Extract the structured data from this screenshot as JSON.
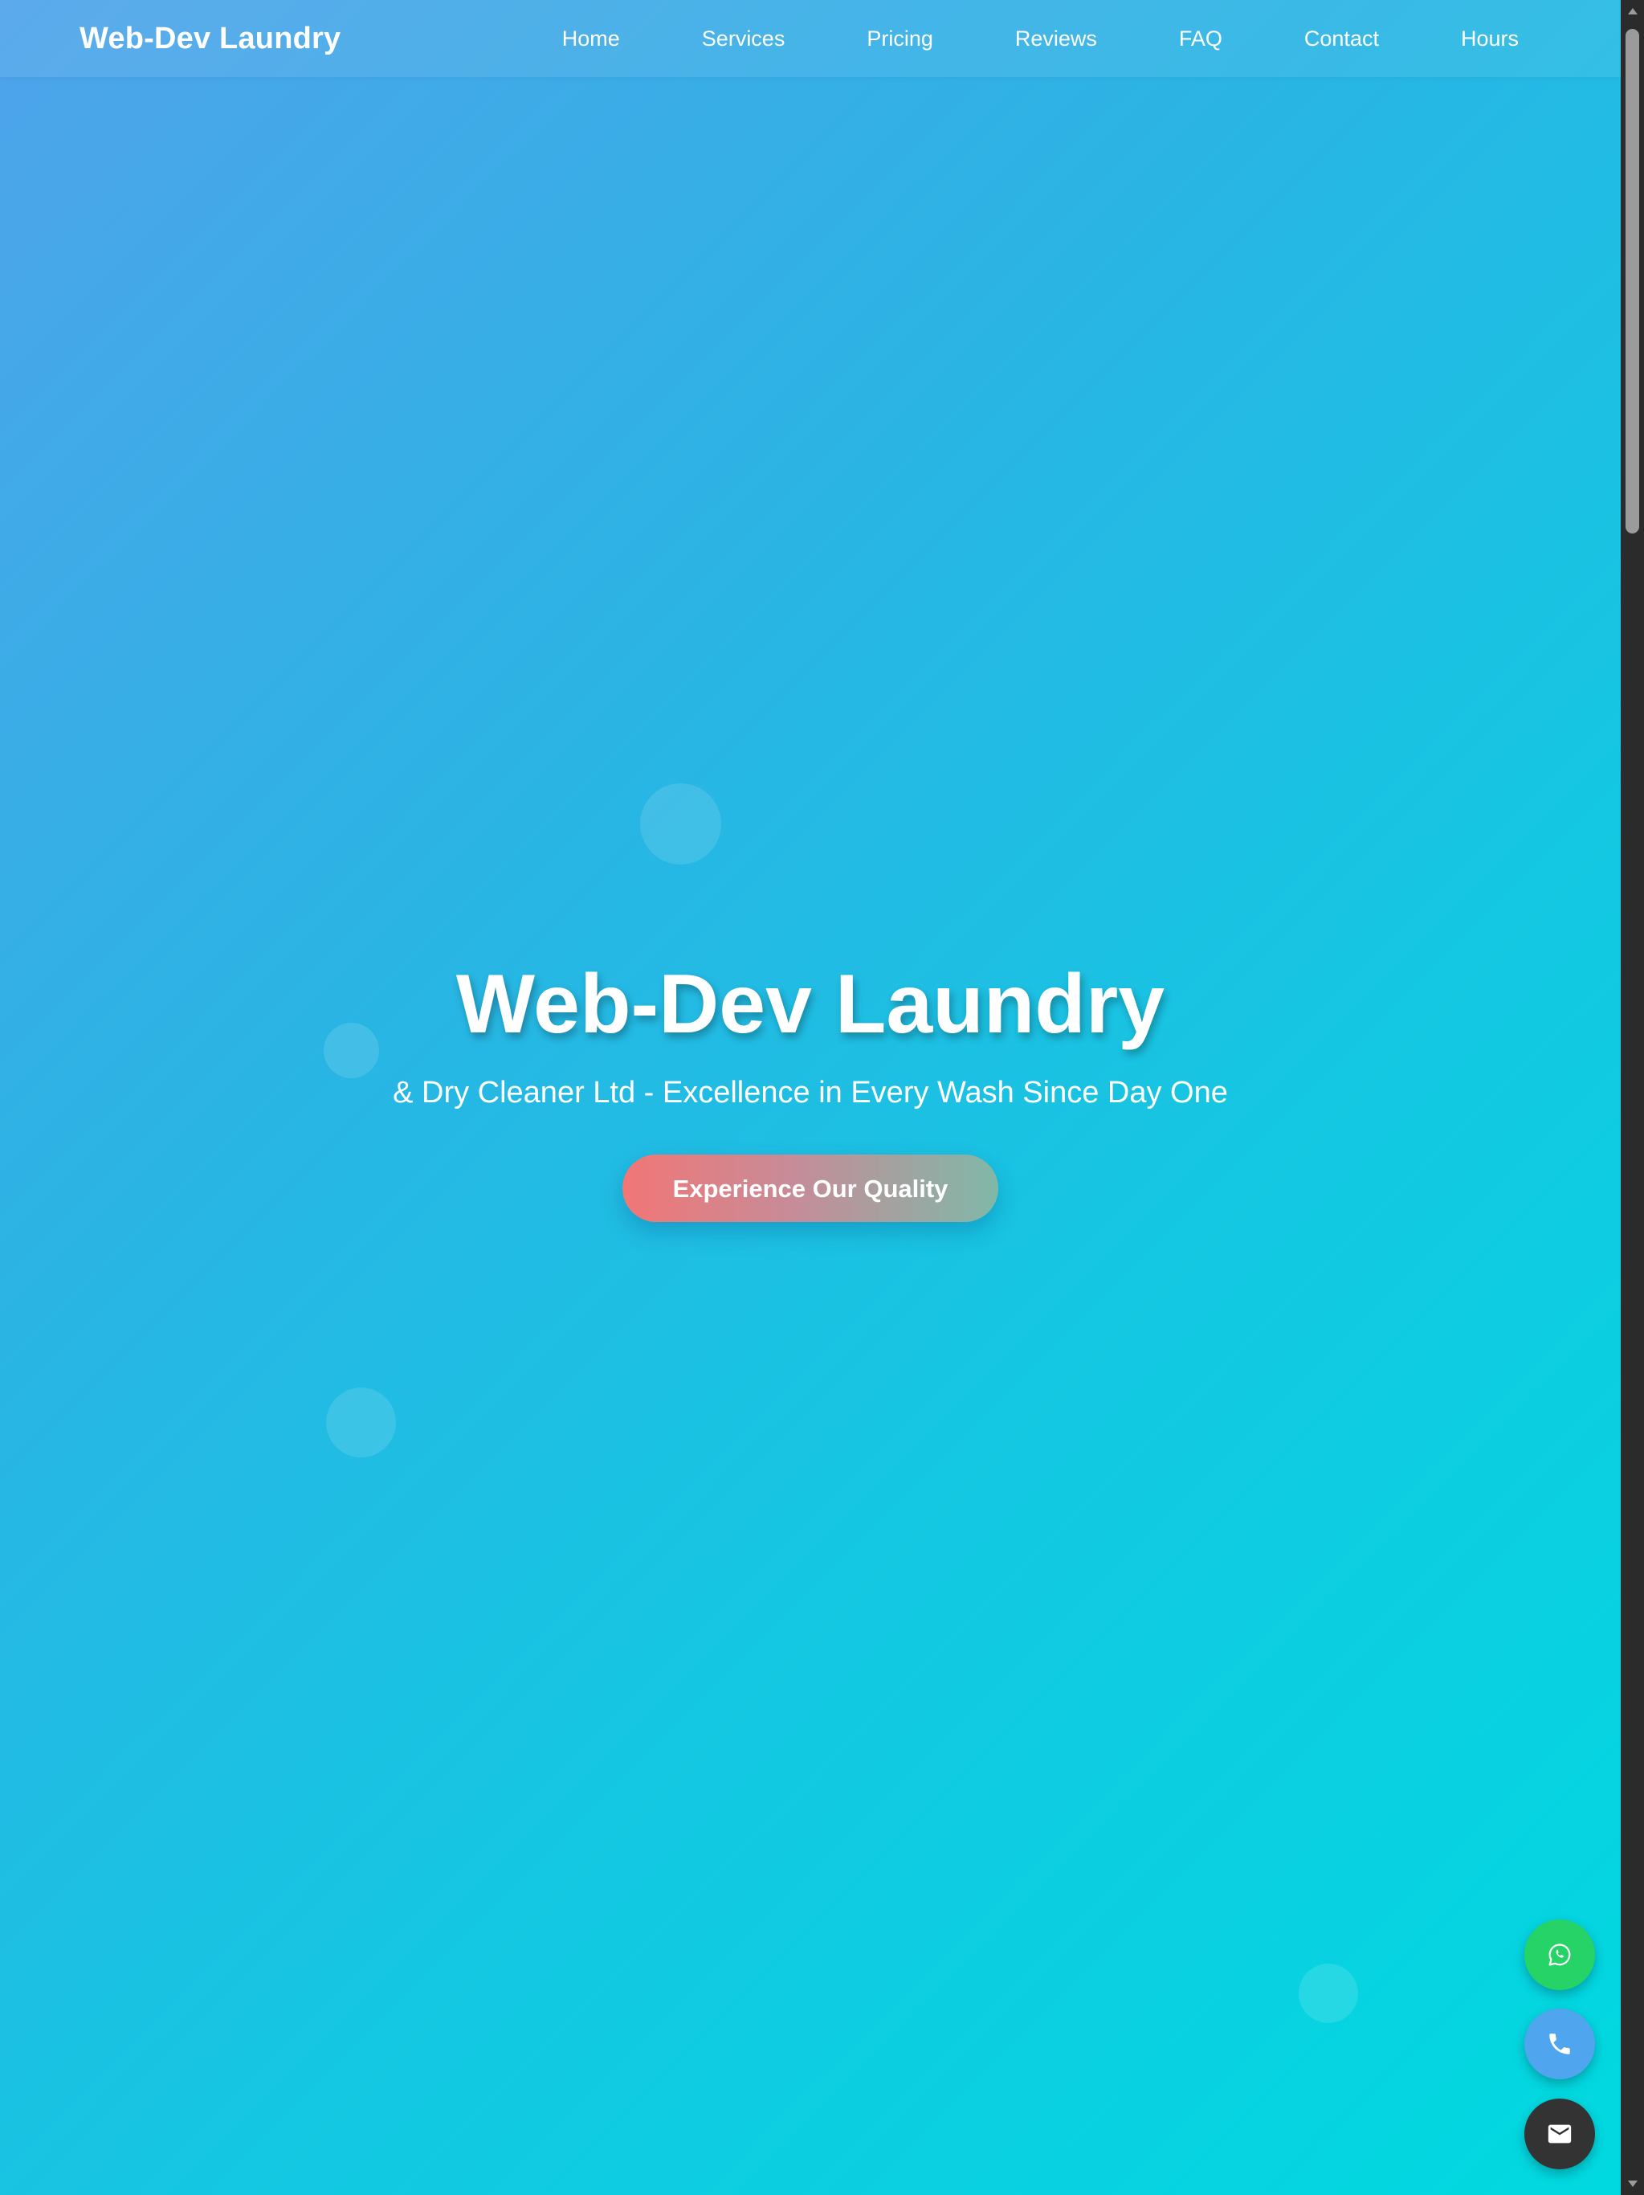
{
  "navbar": {
    "brand": "Web-Dev Laundry",
    "links": [
      {
        "label": "Home"
      },
      {
        "label": "Services"
      },
      {
        "label": "Pricing"
      },
      {
        "label": "Reviews"
      },
      {
        "label": "FAQ"
      },
      {
        "label": "Contact"
      },
      {
        "label": "Hours"
      }
    ]
  },
  "hero": {
    "title": "Web-Dev Laundry",
    "subtitle": "& Dry Cleaner Ltd - Excellence in Every Wash Since Day One",
    "cta_label": "Experience Our Quality"
  },
  "floating_buttons": [
    {
      "icon": "whatsapp-icon",
      "color": "#25d366"
    },
    {
      "icon": "phone-icon",
      "color": "#4fa6ee"
    },
    {
      "icon": "mail-icon",
      "color": "#333333"
    }
  ],
  "colors": {
    "gradient_start": "#4fa3ea",
    "gradient_end": "#00d9e0",
    "cta_start": "#f27676",
    "cta_end": "#80b8a8"
  }
}
